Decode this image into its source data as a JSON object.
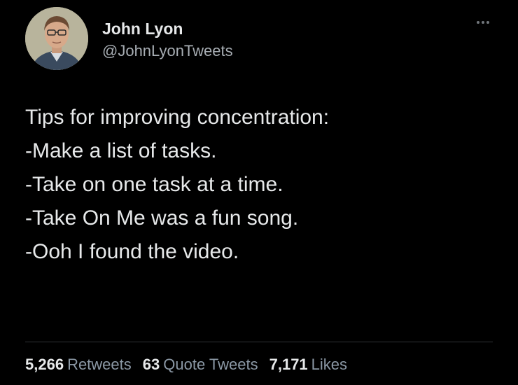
{
  "author": {
    "name": "John Lyon",
    "handle": "@JohnLyonTweets"
  },
  "tweet": {
    "lines": [
      "Tips for improving concentration:",
      "-Make a list of tasks.",
      "-Take on one task at a time.",
      "-Take On Me was a fun song.",
      "-Ooh I found the video."
    ]
  },
  "stats": {
    "retweets": {
      "count": "5,266",
      "label": "Retweets"
    },
    "quote_tweets": {
      "count": "63",
      "label": "Quote Tweets"
    },
    "likes": {
      "count": "7,171",
      "label": "Likes"
    }
  },
  "icons": {
    "more": "more-horizontal-icon",
    "avatar": "profile-photo"
  },
  "colors": {
    "background": "#000000",
    "primary_text": "#e7e9ea",
    "secondary_text": "#8b98a5",
    "divider": "#2f3336"
  }
}
